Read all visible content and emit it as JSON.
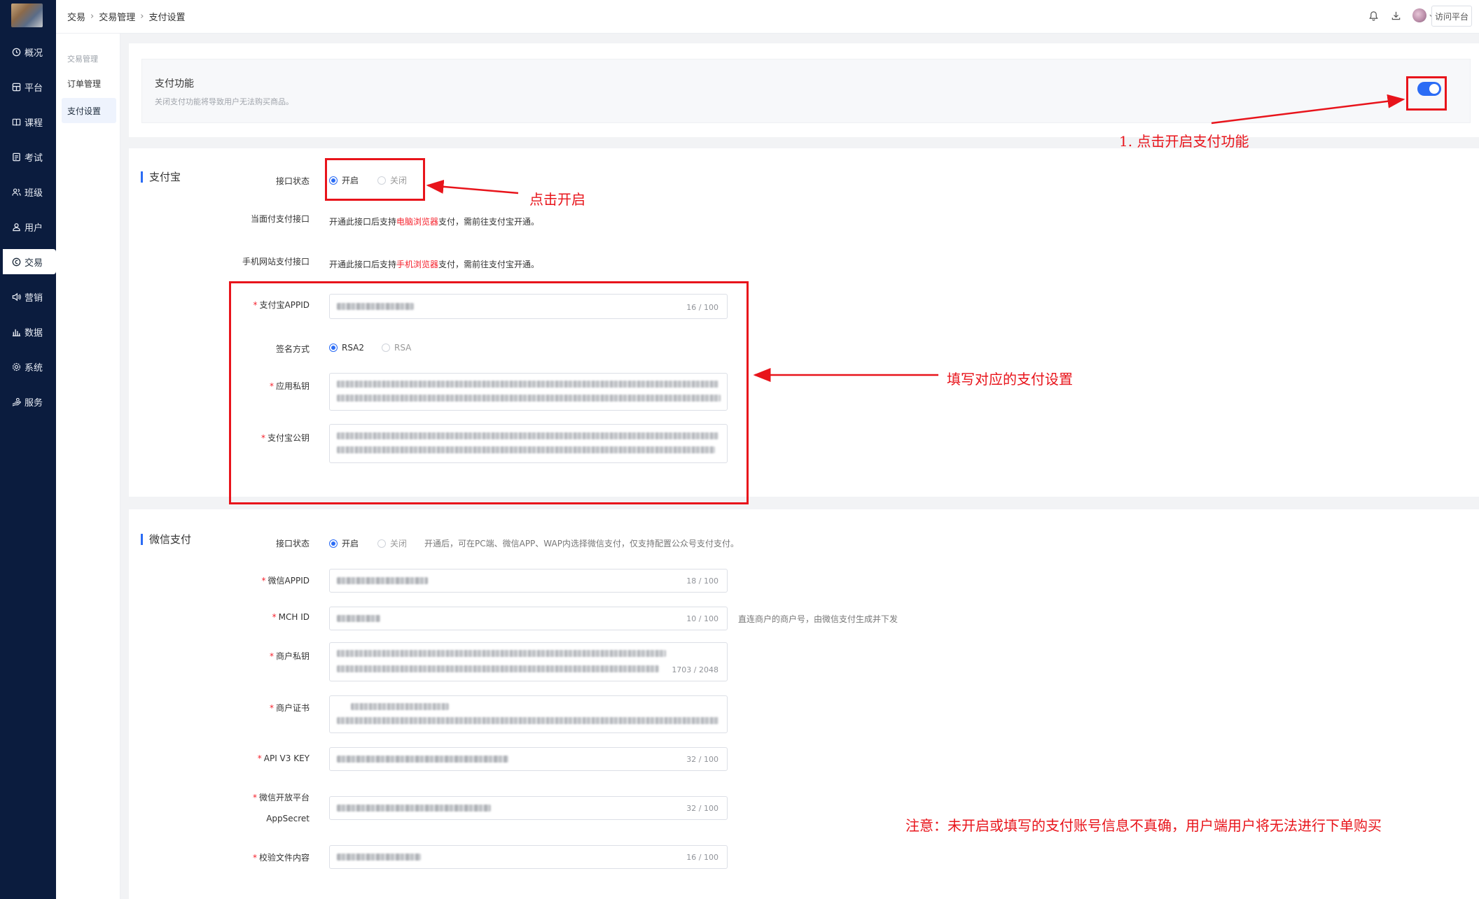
{
  "sidebar": {
    "items": [
      {
        "label": "概况",
        "icon": "clock-icon"
      },
      {
        "label": "平台",
        "icon": "platform-icon"
      },
      {
        "label": "课程",
        "icon": "book-icon"
      },
      {
        "label": "考试",
        "icon": "exam-icon"
      },
      {
        "label": "班级",
        "icon": "class-icon"
      },
      {
        "label": "用户",
        "icon": "user-icon"
      },
      {
        "label": "交易",
        "icon": "trade-icon",
        "active": true
      },
      {
        "label": "营销",
        "icon": "megaphone-icon"
      },
      {
        "label": "数据",
        "icon": "bar-chart-icon"
      },
      {
        "label": "系统",
        "icon": "gear-icon"
      },
      {
        "label": "服务",
        "icon": "service-icon"
      }
    ]
  },
  "submenu": {
    "group": "交易管理",
    "items": [
      {
        "label": "订单管理"
      },
      {
        "label": "支付设置",
        "active": true
      }
    ]
  },
  "header": {
    "breadcrumb": [
      "交易",
      "交易管理",
      "支付设置"
    ],
    "visit_button": "访问平台"
  },
  "payment_toggle": {
    "title": "支付功能",
    "desc": "关闭支付功能将导致用户无法购买商品。",
    "enabled": true
  },
  "alipay": {
    "title": "支付宝",
    "status_label": "接口状态",
    "status_on": "开启",
    "status_off": "关闭",
    "f2f_label": "当面付支付接口",
    "f2f_pre": "开通此接口后支持",
    "f2f_hl": "电脑浏览器",
    "f2f_post": "支付，需前往支付宝开通。",
    "wap_label": "手机网站支付接口",
    "wap_pre": "开通此接口后支持",
    "wap_hl": "手机浏览器",
    "wap_post": "支付，需前往支付宝开通。",
    "appid_label": "支付宝APPID",
    "appid_count": "16 / 100",
    "sign_label": "签名方式",
    "sign_opt1": "RSA2",
    "sign_opt2": "RSA",
    "private_key_label": "应用私钥",
    "public_key_label": "支付宝公钥"
  },
  "wechat": {
    "title": "微信支付",
    "status_label": "接口状态",
    "status_on": "开启",
    "status_off": "关闭",
    "status_hint": "开通后，可在PC端、微信APP、WAP内选择微信支付，仅支持配置公众号支付支付。",
    "appid_label": "微信APPID",
    "appid_count": "18 / 100",
    "mchid_label": "MCH ID",
    "mchid_count": "10 / 100",
    "mchid_hint": "直连商户的商户号，由微信支付生成并下发",
    "merchant_key_label": "商户私钥",
    "merchant_key_count": "1703 / 2048",
    "cert_label": "商户证书",
    "apiv3_label": "API V3 KEY",
    "apiv3_count": "32 / 100",
    "open_secret_label1": "微信开放平台",
    "open_secret_label2": "AppSecret",
    "open_secret_count": "32 / 100",
    "verify_label": "校验文件内容",
    "verify_count": "16 / 100"
  },
  "annotations": {
    "step1": "1.  点击开启支付功能",
    "click_on": "点击开启",
    "fill": "填写对应的支付设置",
    "note": "注意：未开启或填写的支付账号信息不真确，用户端用户将无法进行下单购买"
  },
  "colors": {
    "sidebar_bg": "#0b1c3e",
    "accent": "#2b6cf5",
    "annotation_red": "#e8141b",
    "required_red": "#f5222d"
  }
}
